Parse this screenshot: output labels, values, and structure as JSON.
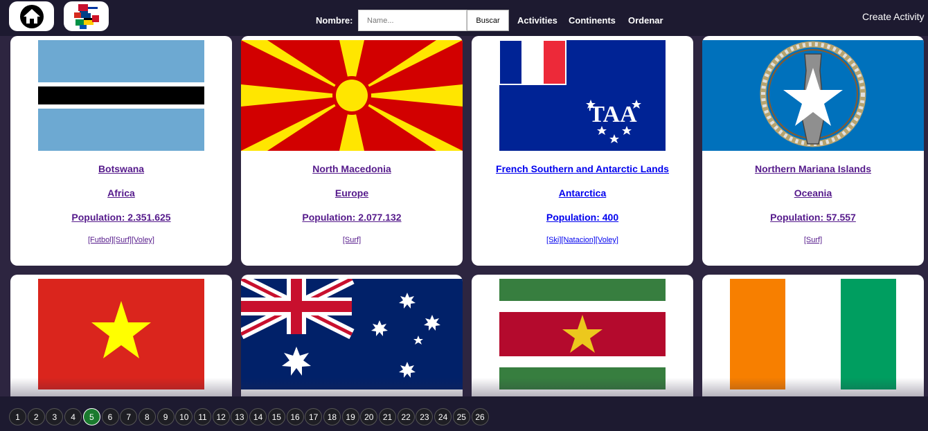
{
  "header": {
    "name_label": "Nombre:",
    "search_placeholder": "Name...",
    "search_value": "",
    "search_button": "Buscar",
    "nav": [
      "Activities",
      "Continents",
      "Ordenar"
    ],
    "create_activity": "Create Activity"
  },
  "cards": [
    {
      "name": "Botswana",
      "continent": "Africa",
      "population": "Population: 2.351.625",
      "activities": "[Futbol][Surf][Voley]",
      "link_state": "visited"
    },
    {
      "name": "North Macedonia",
      "continent": "Europe",
      "population": "Population: 2.077.132",
      "activities": "[Surf]",
      "link_state": "visited"
    },
    {
      "name": "French Southern and Antarctic Lands",
      "continent": "Antarctica",
      "population": "Population: 400",
      "activities": "[Ski][Natacion][Voley]",
      "link_state": "unvisited"
    },
    {
      "name": "Northern Mariana Islands",
      "continent": "Oceania",
      "population": "Population: 57.557",
      "activities": "[Surf]",
      "link_state": "visited"
    },
    {
      "name": "",
      "continent": "",
      "population": "",
      "activities": "",
      "flag": "vietnam-flag"
    },
    {
      "name": "",
      "continent": "",
      "population": "",
      "activities": "",
      "flag": "australia-flag"
    },
    {
      "name": "",
      "continent": "",
      "population": "",
      "activities": "",
      "flag": "suriname-flag"
    },
    {
      "name": "",
      "continent": "",
      "population": "",
      "activities": "",
      "flag": "ivory-coast-flag"
    }
  ],
  "pagination": {
    "pages": [
      "1",
      "2",
      "3",
      "4",
      "5",
      "6",
      "7",
      "8",
      "9",
      "10",
      "11",
      "12",
      "13",
      "14",
      "15",
      "16",
      "17",
      "18",
      "19",
      "20",
      "21",
      "22",
      "23",
      "24",
      "25",
      "26"
    ],
    "current": "5"
  },
  "colors": {
    "topbar": "#1d1a30",
    "background": "#2d2540",
    "active_page": "#1a7a2e",
    "visited_link": "#551a8b",
    "link": "#0000ee"
  },
  "icons": [
    "home-icon",
    "world-flags-logo-icon"
  ]
}
